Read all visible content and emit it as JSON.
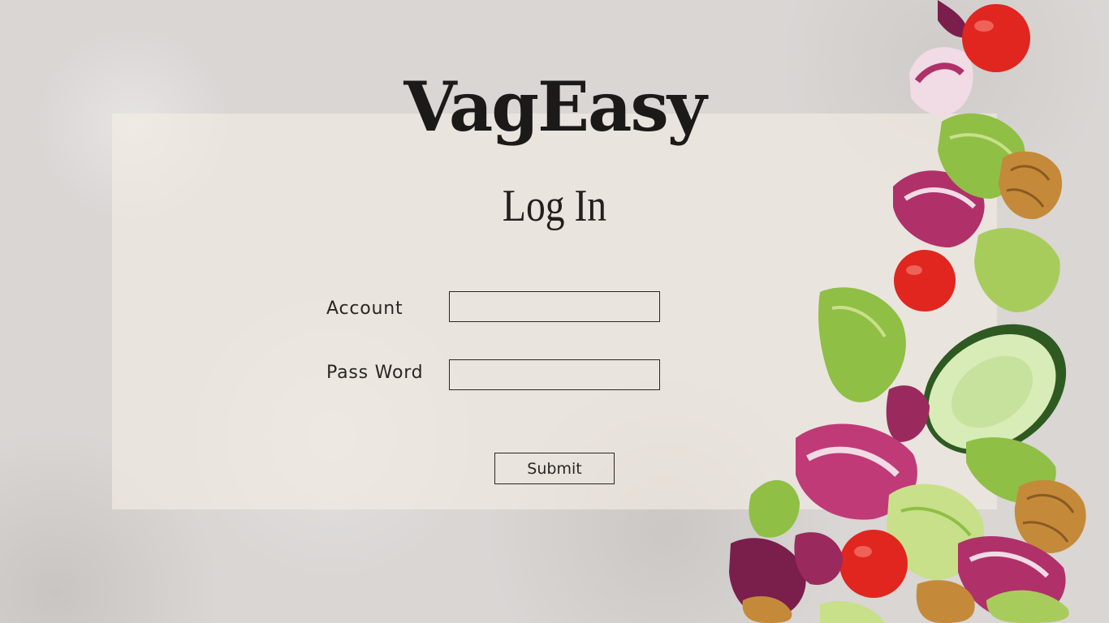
{
  "brand": {
    "name": "VagEasy"
  },
  "login": {
    "title": "Log In",
    "account_label": "Account",
    "account_value": "",
    "password_label": "Pass Word",
    "password_value": "",
    "submit_label": "Submit"
  },
  "colors": {
    "background": "#d9d6d4",
    "panel": "#f3eee4",
    "text": "#1c1a19",
    "tomato": "#e0261f",
    "radicchio": "#b0306a",
    "lettuce": "#8fbf45",
    "cucumber": "#2e5a22",
    "walnut": "#c48a3a"
  }
}
